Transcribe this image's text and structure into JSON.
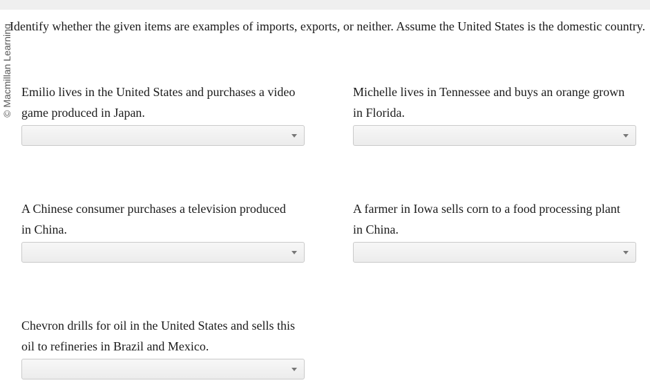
{
  "credit": "© Macmillan Learning",
  "instructions": "Identify whether the given items are examples of imports, exports, or neither. Assume the United States is the domestic country.",
  "questions": [
    {
      "line1": "Emilio lives in the United States and purchases a video",
      "line2": "game produced in Japan.",
      "selected": ""
    },
    {
      "line1": "Michelle lives in Tennessee and buys an orange grown",
      "line2": "in Florida.",
      "selected": ""
    },
    {
      "line1": "A Chinese consumer purchases a television produced",
      "line2": "in China.",
      "selected": ""
    },
    {
      "line1": "A farmer in Iowa sells corn to a food processing plant",
      "line2": "in China.",
      "selected": ""
    },
    {
      "line1": "Chevron drills for oil in the United States and sells this",
      "line2": "oil to refineries in Brazil and Mexico.",
      "selected": ""
    }
  ],
  "icons": {
    "dropdown": "chevron-down-icon"
  }
}
